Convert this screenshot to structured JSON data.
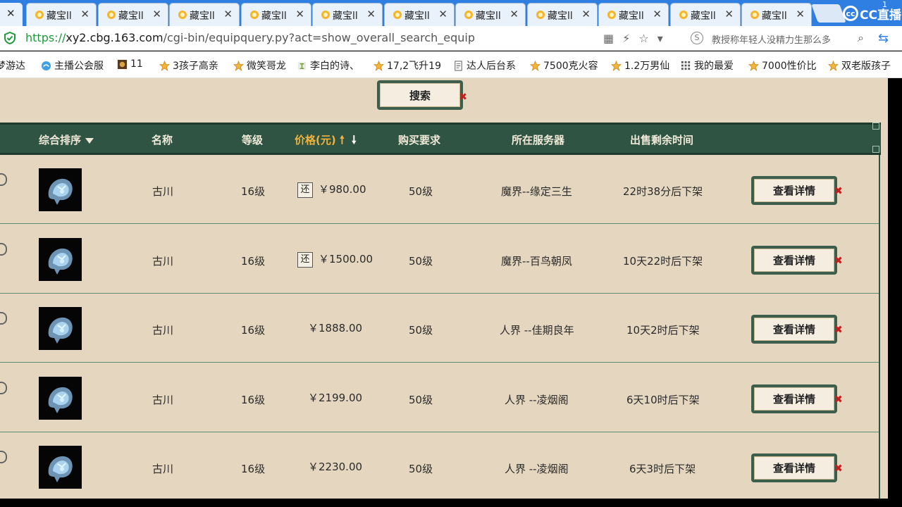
{
  "browser": {
    "tabs": [
      {
        "title": "藏宝ll"
      },
      {
        "title": "藏宝ll"
      },
      {
        "title": "藏宝ll"
      },
      {
        "title": "藏宝ll"
      },
      {
        "title": "藏宝ll"
      },
      {
        "title": "藏宝ll"
      },
      {
        "title": "藏宝ll"
      },
      {
        "title": "藏宝ll"
      },
      {
        "title": "藏宝ll"
      },
      {
        "title": "藏宝ll"
      },
      {
        "title": "藏宝ll"
      }
    ],
    "tab_close_glyph": "✕",
    "corner_number": "1",
    "overlay_logo": "CC直播",
    "url": {
      "scheme": "https://",
      "domain": "xy2.cbg.163.com",
      "path": "/cgi-bin/equipquery.py?act=show_overall_search_equip"
    },
    "search_hint": "教授称年轻人没精力生那么多",
    "bookmarks": [
      "梦游达",
      "主播公会服",
      "11",
      "3孩子高亲",
      "微笑哥龙",
      "李白的诗、",
      "17,2飞升19",
      "达人后台系",
      "7500克火容",
      "1.2万男仙",
      "我的最爱",
      "7000性价比",
      "双老版孩子"
    ]
  },
  "page": {
    "search_label": "搜索",
    "columns": {
      "sort": "综合排序",
      "name": "名称",
      "level": "等级",
      "price": "价格(元)",
      "requirement": "购买要求",
      "server": "所在服务器",
      "time_left": "出售剩余时间"
    },
    "detail_label": "查看详情",
    "return_badge": "还",
    "rows": [
      {
        "name": "古川",
        "level": "16级",
        "price": "￥980.00",
        "returnable": true,
        "requirement": "50级",
        "server": "魔界--缘定三生",
        "time_left": "22时38分后下架"
      },
      {
        "name": "古川",
        "level": "16级",
        "price": "￥1500.00",
        "returnable": true,
        "requirement": "50级",
        "server": "魔界--百鸟朝凤",
        "time_left": "10天22时后下架"
      },
      {
        "name": "古川",
        "level": "16级",
        "price": "￥1888.00",
        "returnable": false,
        "requirement": "50级",
        "server": "人界 --佳期良年",
        "time_left": "10天2时后下架"
      },
      {
        "name": "古川",
        "level": "16级",
        "price": "￥2199.00",
        "returnable": false,
        "requirement": "50级",
        "server": "人界 --凌烟阁",
        "time_left": "6天10时后下架"
      },
      {
        "name": "古川",
        "level": "16级",
        "price": "￥2230.00",
        "returnable": false,
        "requirement": "50级",
        "server": "人界 --凌烟阁",
        "time_left": "6天3时后下架"
      }
    ]
  },
  "colors": {
    "tabbar": "#2f7fe3",
    "page_bg": "#e5d7bf",
    "header_bg": "#2f5443",
    "header_highlight": "#f2b33d"
  }
}
